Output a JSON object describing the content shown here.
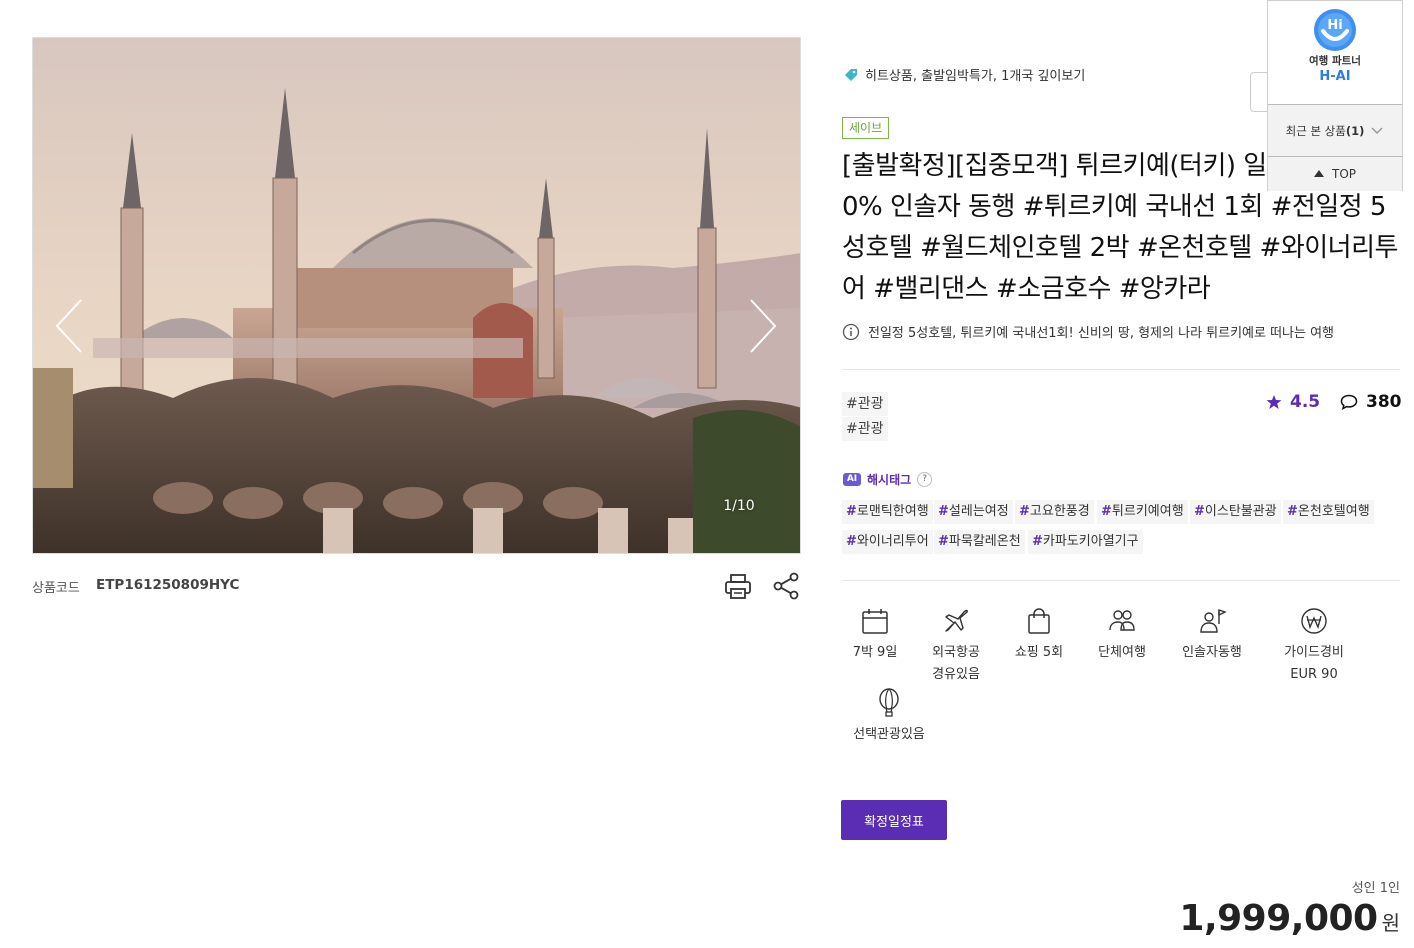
{
  "gallery": {
    "counter": "1/10"
  },
  "product_code": {
    "label": "상품코드",
    "value": "ETP161250809HYC"
  },
  "categories": "히트상품, 출발임박특가, 1개국 깊이보기",
  "badge": "세이브",
  "title": "[출발확정][집중모객] 튀르키예(터키) 일주 9일 #100% 인솔자 동행 #튀르키예 국내선 1회 #전일정 5성호텔 #월드체인호텔 2박 #온천호텔 #와이너리투어 #밸리댄스 #소금호수 #앙카라",
  "title_lines": [
    "[출발확정][집중모객] 튀르키예(터키) 일",
    "0% 인솔자 동행 #튀르키예 국내선 1회 #전일정 5",
    "성호텔 #월드체인호텔 2박 #온천호텔 #와이너리투",
    "어 #밸리댄스 #소금호수 #앙카라"
  ],
  "summary": "전일정 5성호텔, 튀르키예 국내선1회! 신비의 땅, 형제의 나라 튀르키예로 떠나는 여행",
  "plain_tags": [
    "#관광",
    "#관광"
  ],
  "rating": "4.5",
  "review_count": "380",
  "ai_hashtag_label": "해시태그",
  "ai_badge": "AI",
  "hashtags": [
    "로맨틱한여행",
    "설레는여정",
    "고요한풍경",
    "튀르키예여행",
    "이스탄불관광",
    "온천호텔여행",
    "와이너리투어",
    "파묵칼레온천",
    "카파도키아열기구"
  ],
  "features": [
    {
      "icon": "calendar-icon",
      "line1": "7박 9일",
      "line2": ""
    },
    {
      "icon": "airplane-icon",
      "line1": "외국항공",
      "line2": "경유있음"
    },
    {
      "icon": "shopping-bag-icon",
      "line1": "쇼핑 5회",
      "line2": ""
    },
    {
      "icon": "group-icon",
      "line1": "단체여행",
      "line2": ""
    },
    {
      "icon": "guide-icon",
      "line1": "인솔자동행",
      "line2": ""
    },
    {
      "icon": "won-icon",
      "line1": "가이드경비",
      "line2": "EUR 90"
    },
    {
      "icon": "balloon-icon",
      "line1": "선택관광있음",
      "line2": ""
    }
  ],
  "schedule_button": "확정일정표",
  "price": {
    "label": "성인 1인",
    "value": "1,999,000",
    "unit": "원"
  },
  "floating": {
    "hai_line1": "여행 파트너",
    "hai_line2": "H-AI",
    "recent_label": "최근 본 상품",
    "recent_count": "(1)",
    "top_label": "TOP"
  },
  "colors": {
    "brand": "#5b2db5",
    "save_badge": "#7ab648",
    "hai_blue": "#2e7de0"
  }
}
